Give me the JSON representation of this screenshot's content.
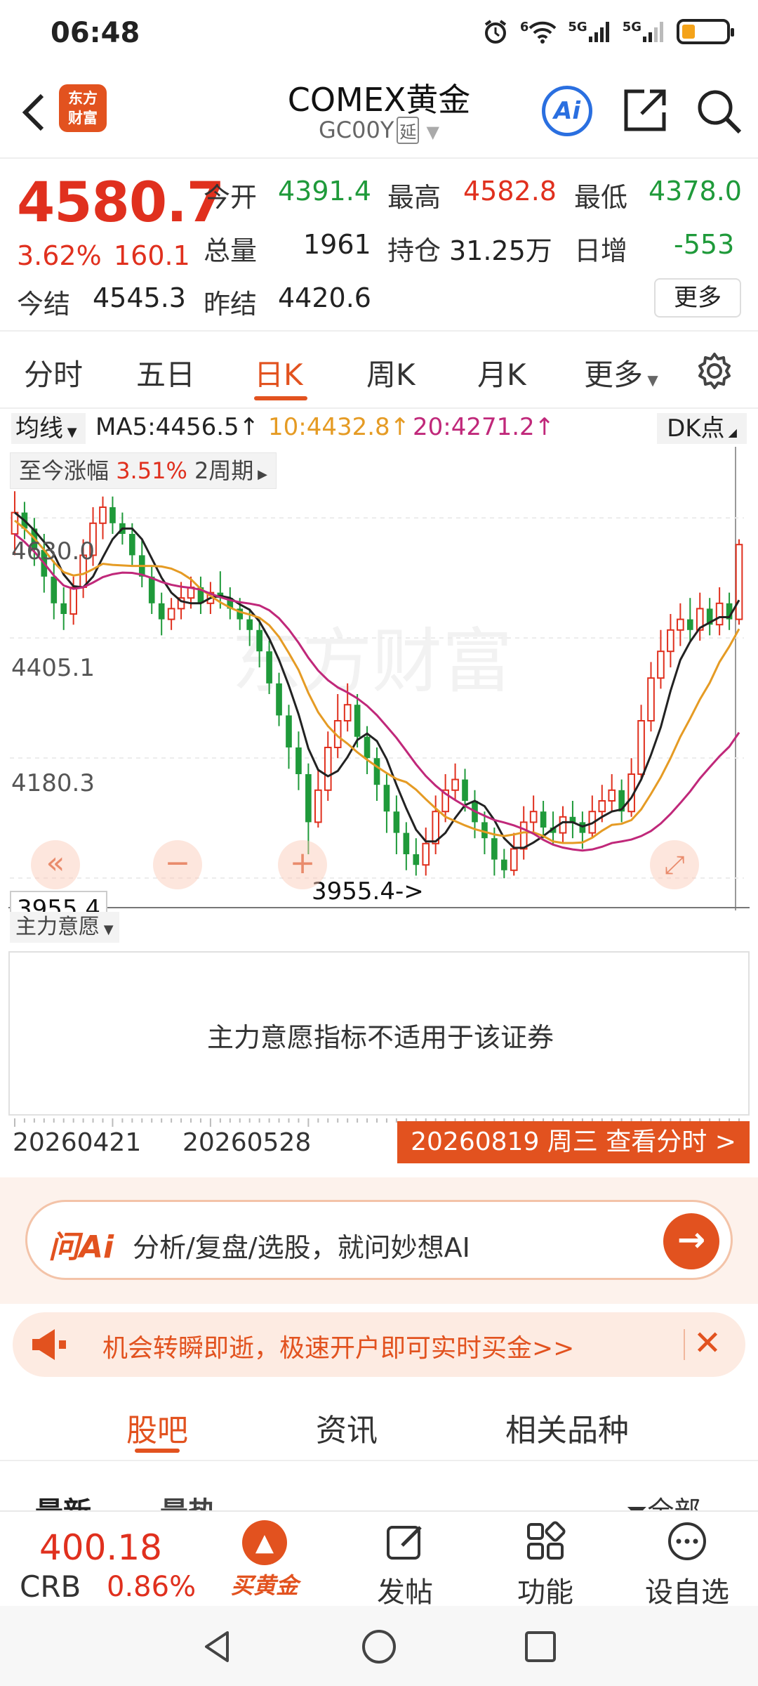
{
  "status_bar": {
    "time": "06:48",
    "signal1": "5G",
    "signal2": "5G",
    "wifi_label": "6",
    "battery_percent": 30
  },
  "header": {
    "back_icon": "chevron-left-icon",
    "logo_text_line1": "东方",
    "logo_text_line2": "财富",
    "title": "COMEX黄金",
    "code": "GC00Y",
    "delay_tag": "延",
    "ai_label": "Ai"
  },
  "quote": {
    "price": "4580.7",
    "change_pct": "3.62%",
    "change_abs": "160.1",
    "open_label": "今开",
    "open": "4391.4",
    "high_label": "最高",
    "high": "4582.8",
    "low_label": "最低",
    "low": "4378.0",
    "volume_label": "总量",
    "volume": "1961",
    "position_label": "持仓",
    "position": "31.25万",
    "daily_inc_label": "日增",
    "daily_inc": "-553",
    "settle_label": "今结",
    "settle": "4545.3",
    "prev_settle_label": "昨结",
    "prev_settle": "4420.6",
    "more_label": "更多"
  },
  "period_tabs": {
    "items": [
      "分时",
      "五日",
      "日K",
      "周K",
      "月K",
      "更多"
    ],
    "active": "日K"
  },
  "ma_row": {
    "dropdown_label": "均线",
    "ma5": "MA5:4456.5↑",
    "ma10": "10:4432.8↑",
    "ma20": "20:4271.2↑",
    "dk_label": "DK点"
  },
  "chart": {
    "range_label": "至今涨幅",
    "range_value": "3.51%",
    "range_period": "2周期",
    "y_ticks": [
      "4630.0",
      "4405.1",
      "4180.3"
    ],
    "low_marker": "3955.4->",
    "low_axis_label": "3955.4",
    "watermark": "东方财富",
    "zoom_prev_icon": "rewind-icon",
    "zoom_out_icon": "minus-icon",
    "zoom_in_icon": "plus-icon",
    "fullscreen_icon": "expand-icon"
  },
  "chart_data": {
    "type": "candlestick",
    "title": "",
    "ylim": [
      3900,
      4700
    ],
    "y_ticks": [
      4630.0,
      4405.1,
      4180.3,
      3955.4
    ],
    "x_labels": [
      "20260421",
      "20260528"
    ],
    "candles": [
      [
        4600,
        4640,
        4560,
        4680
      ],
      [
        4640,
        4610,
        4590,
        4660
      ],
      [
        4610,
        4570,
        4540,
        4630
      ],
      [
        4570,
        4520,
        4490,
        4600
      ],
      [
        4520,
        4470,
        4440,
        4550
      ],
      [
        4470,
        4450,
        4420,
        4500
      ],
      [
        4450,
        4500,
        4430,
        4520
      ],
      [
        4500,
        4560,
        4480,
        4590
      ],
      [
        4560,
        4620,
        4540,
        4650
      ],
      [
        4620,
        4650,
        4590,
        4670
      ],
      [
        4650,
        4620,
        4600,
        4670
      ],
      [
        4620,
        4600,
        4580,
        4640
      ],
      [
        4600,
        4560,
        4540,
        4620
      ],
      [
        4560,
        4520,
        4500,
        4590
      ],
      [
        4520,
        4470,
        4450,
        4540
      ],
      [
        4470,
        4440,
        4410,
        4490
      ],
      [
        4440,
        4460,
        4420,
        4480
      ],
      [
        4460,
        4480,
        4440,
        4510
      ],
      [
        4480,
        4500,
        4460,
        4520
      ],
      [
        4500,
        4470,
        4450,
        4520
      ],
      [
        4470,
        4490,
        4450,
        4510
      ],
      [
        4490,
        4480,
        4460,
        4530
      ],
      [
        4480,
        4460,
        4440,
        4500
      ],
      [
        4460,
        4440,
        4420,
        4480
      ],
      [
        4440,
        4420,
        4390,
        4460
      ],
      [
        4420,
        4380,
        4350,
        4440
      ],
      [
        4380,
        4320,
        4300,
        4400
      ],
      [
        4320,
        4260,
        4240,
        4340
      ],
      [
        4260,
        4200,
        4160,
        4280
      ],
      [
        4200,
        4150,
        4120,
        4230
      ],
      [
        4150,
        4060,
        4000,
        4170
      ],
      [
        4060,
        4120,
        4050,
        4160
      ],
      [
        4120,
        4200,
        4100,
        4230
      ],
      [
        4200,
        4250,
        4180,
        4300
      ],
      [
        4250,
        4280,
        4230,
        4320
      ],
      [
        4280,
        4220,
        4200,
        4300
      ],
      [
        4220,
        4180,
        4150,
        4240
      ],
      [
        4180,
        4130,
        4100,
        4200
      ],
      [
        4130,
        4080,
        4040,
        4150
      ],
      [
        4080,
        4040,
        4000,
        4110
      ],
      [
        4040,
        4000,
        3970,
        4060
      ],
      [
        4000,
        3980,
        3960,
        4030
      ],
      [
        3980,
        4020,
        3960,
        4050
      ],
      [
        4020,
        4080,
        4000,
        4110
      ],
      [
        4080,
        4120,
        4060,
        4150
      ],
      [
        4120,
        4140,
        4100,
        4170
      ],
      [
        4140,
        4100,
        4080,
        4160
      ],
      [
        4100,
        4060,
        4030,
        4120
      ],
      [
        4060,
        4030,
        4000,
        4080
      ],
      [
        4030,
        3990,
        3960,
        4050
      ],
      [
        3990,
        3970,
        3955,
        4010
      ],
      [
        3970,
        4010,
        3960,
        4040
      ],
      [
        4010,
        4060,
        3990,
        4090
      ],
      [
        4060,
        4080,
        4040,
        4110
      ],
      [
        4080,
        4050,
        4030,
        4100
      ],
      [
        4050,
        4040,
        4020,
        4080
      ],
      [
        4040,
        4070,
        4020,
        4090
      ],
      [
        4070,
        4060,
        4030,
        4100
      ],
      [
        4060,
        4040,
        4010,
        4080
      ],
      [
        4040,
        4080,
        4030,
        4110
      ],
      [
        4080,
        4100,
        4060,
        4130
      ],
      [
        4100,
        4120,
        4080,
        4150
      ],
      [
        4120,
        4080,
        4060,
        4140
      ],
      [
        4080,
        4150,
        4070,
        4180
      ],
      [
        4150,
        4250,
        4140,
        4280
      ],
      [
        4250,
        4330,
        4230,
        4360
      ],
      [
        4330,
        4380,
        4310,
        4420
      ],
      [
        4380,
        4420,
        4350,
        4450
      ],
      [
        4420,
        4440,
        4390,
        4470
      ],
      [
        4440,
        4420,
        4400,
        4480
      ],
      [
        4420,
        4460,
        4400,
        4490
      ],
      [
        4460,
        4430,
        4410,
        4480
      ],
      [
        4430,
        4470,
        4410,
        4500
      ],
      [
        4470,
        4440,
        4420,
        4490
      ],
      [
        4440,
        4580,
        4430,
        4590
      ]
    ],
    "series": [
      {
        "name": "MA5",
        "color": "#222222"
      },
      {
        "name": "MA10",
        "color": "#e59b24"
      },
      {
        "name": "MA20",
        "color": "#c0287a"
      }
    ],
    "up_color": "#e0301e",
    "down_color": "#1f9a3a"
  },
  "indicator": {
    "dropdown_label": "主力意愿",
    "message": "主力意愿指标不适用于该证券"
  },
  "date_axis": {
    "date1": "20260421",
    "date2": "20260528",
    "badge": "20260819 周三 查看分时 >"
  },
  "ask_ai": {
    "logo": "问Ai",
    "text": "分析/复盘/选股，就问妙想AI",
    "go_icon": "arrow-right-icon"
  },
  "promo": {
    "text": "机会转瞬即逝，极速开户即可实时买金>>",
    "icon": "megaphone-icon",
    "close_icon": "close-icon"
  },
  "content_tabs": {
    "items": [
      "股吧",
      "资讯",
      "相关品种"
    ],
    "active": "股吧"
  },
  "filter_row": {
    "newest": "最新",
    "hot": "最热",
    "all": "全部"
  },
  "bottom_bar": {
    "crb_price": "400.18",
    "crb_name": "CRB",
    "crb_pct": "0.86%",
    "buy_gold": "买黄金",
    "post": "发帖",
    "function": "功能",
    "watchlist": "设自选"
  },
  "colors": {
    "accent": "#e2521f",
    "up": "#e0301e",
    "down": "#1f9a3a"
  }
}
